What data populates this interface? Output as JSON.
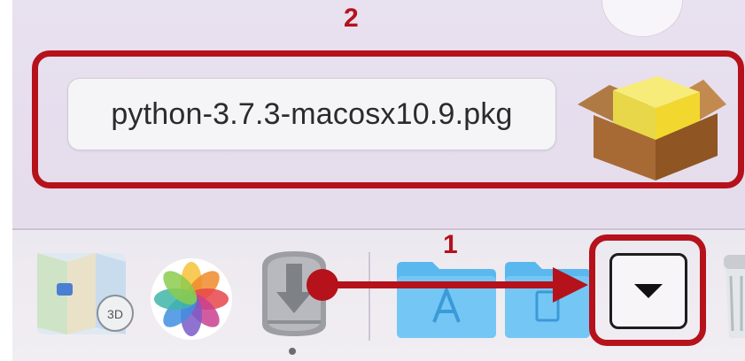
{
  "stack_popup": {
    "filename": "python-3.7.3-macosx10.9.pkg",
    "icon": "package-box-icon"
  },
  "annotations": {
    "label_1": "1",
    "label_2": "2",
    "accent_color": "#b5121b"
  },
  "dock": {
    "items": [
      {
        "name": "Maps",
        "icon": "maps-icon"
      },
      {
        "name": "Photos",
        "icon": "photos-icon"
      },
      {
        "name": "Downloads",
        "icon": "downloads-disk-icon"
      },
      {
        "name": "Applications",
        "icon": "applications-folder-icon"
      },
      {
        "name": "Documents",
        "icon": "documents-folder-icon"
      },
      {
        "name": "Expand",
        "icon": "chevron-down-icon"
      },
      {
        "name": "Trash",
        "icon": "trash-icon"
      }
    ]
  }
}
